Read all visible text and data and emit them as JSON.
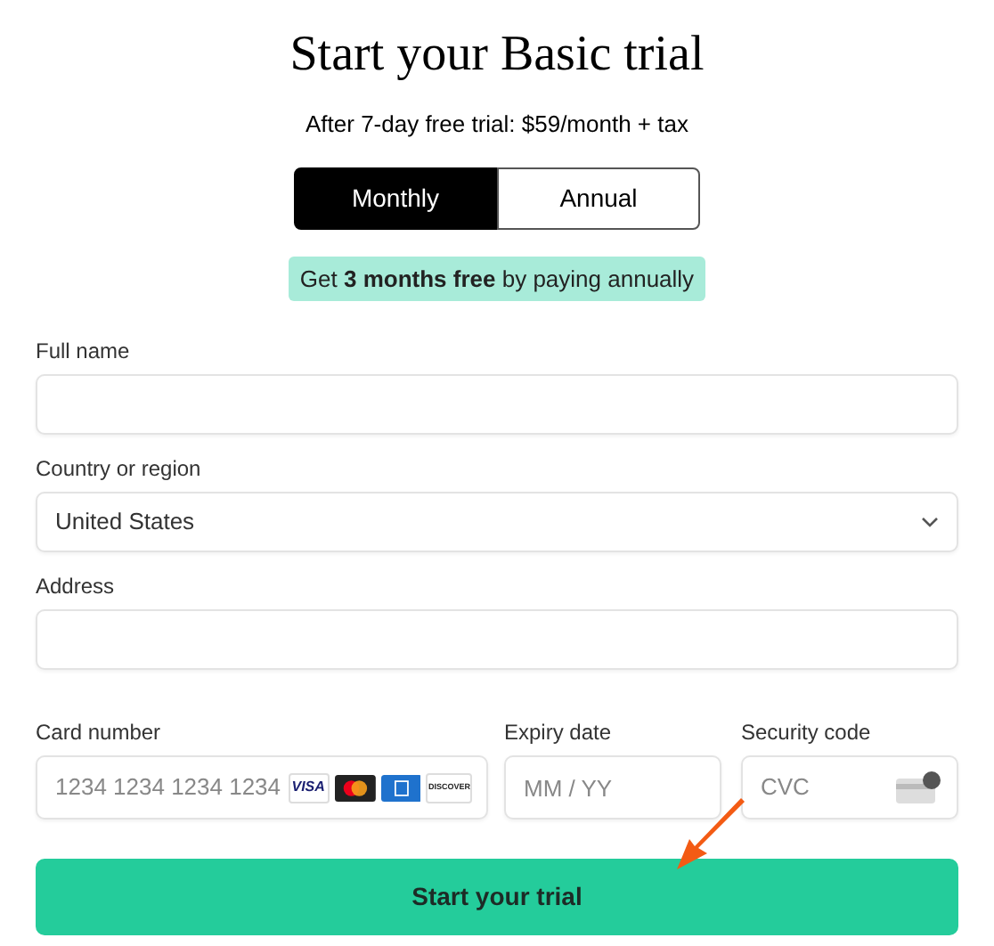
{
  "title": "Start your Basic trial",
  "subtitle": "After 7-day free trial: $59/month + tax",
  "billing_tabs": [
    {
      "label": "Monthly",
      "selected": true
    },
    {
      "label": "Annual",
      "selected": false
    }
  ],
  "promo": "Get **3 months free** by paying annually",
  "fields": [
    {
      "kind": "text",
      "label": "Full name"
    },
    {
      "kind": "select",
      "label": "Country or region",
      "value": "United States"
    },
    {
      "kind": "text",
      "label": "Address"
    }
  ],
  "card": {
    "label": "Card number",
    "placeholder": "1234 1234 1234 1234",
    "brands": [
      {
        "kind": "visa",
        "text": "VISA"
      },
      {
        "kind": "mastercard"
      },
      {
        "kind": "amex"
      },
      {
        "kind": "discover",
        "text": "DISCOVER"
      }
    ]
  },
  "expiry": {
    "label": "Expiry date",
    "placeholder": "MM / YY"
  },
  "security": {
    "label": "Security code",
    "placeholder": "CVC"
  },
  "submit": "Start your trial"
}
